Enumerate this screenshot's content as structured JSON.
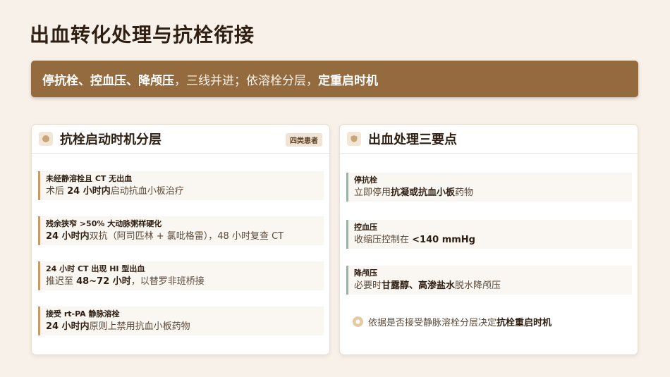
{
  "title": "出血转化处理与抗栓衔接",
  "banner": {
    "p1": "停抗栓、控血压、降颅压",
    "p2": "，三线并进；依溶栓分层，",
    "p3": "定重启时机"
  },
  "left_card": {
    "title": "抗栓启动时机分层",
    "badge": "四类患者",
    "icon": "layers-icon",
    "items": [
      {
        "heading": "未经静溶栓且 CT 无出血",
        "d1": "术后 ",
        "d2": "24 小时内",
        "d3": "启动抗血小板治疗"
      },
      {
        "heading": "残余狭窄 >50% 大动脉粥样硬化",
        "d1": "",
        "d2": "24 小时内",
        "d3": "双抗（阿司匹林 + 氯吡格雷），48 小时复查 CT"
      },
      {
        "heading": "24 小时 CT 出现 HI 型出血",
        "d1": "推迟至 ",
        "d2": "48~72 小时",
        "d3": "，以替罗非班桥接"
      },
      {
        "heading": "接受 rt-PA 静脉溶栓",
        "d1": "",
        "d2": "24 小时内",
        "d3": "原则上禁用抗血小板药物"
      }
    ]
  },
  "right_card": {
    "title": "出血处理三要点",
    "icon": "shield-icon",
    "items": [
      {
        "heading": "停抗栓",
        "d1": "立即停用",
        "d2": "抗凝或抗血小板",
        "d3": "药物"
      },
      {
        "heading": "控血压",
        "d1": "收缩压控制在 ",
        "d2": "<140 mmHg",
        "d3": ""
      },
      {
        "heading": "降颅压",
        "d1": "必要时",
        "d2": "甘露醇、高渗盐水",
        "d3": "脱水降颅压"
      }
    ],
    "note": {
      "n1": "依据是否接受静脉溶栓分层决定",
      "n2": "抗栓重启时机",
      "icon": "info-icon"
    }
  },
  "colors": {
    "accent": "#946a3f",
    "left_bar": "#c79a66",
    "right_bar": "#8fb8a3"
  }
}
